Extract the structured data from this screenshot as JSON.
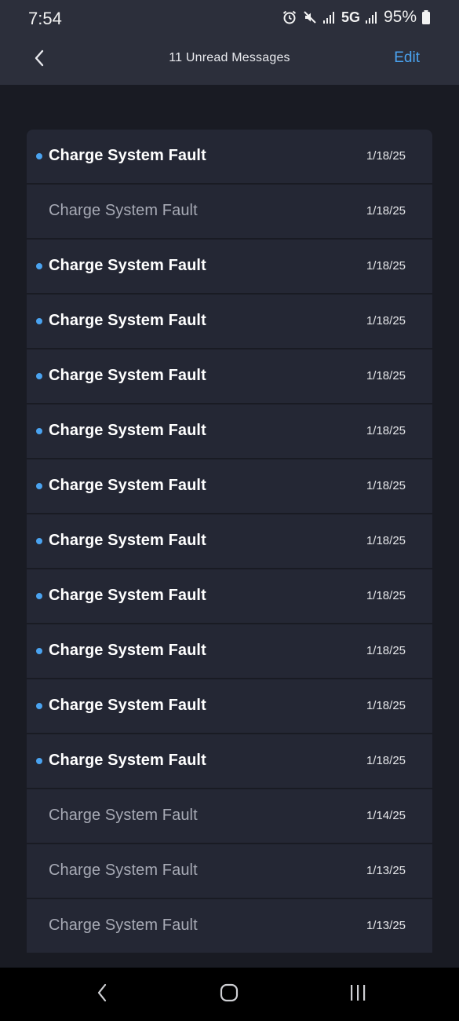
{
  "status_bar": {
    "time": "7:54",
    "network": "5G",
    "battery": "95%",
    "icons": [
      "alarm-icon",
      "mute-icon",
      "signal-icon",
      "signal-icon",
      "battery-icon"
    ]
  },
  "header": {
    "title": "11 Unread Messages",
    "edit_label": "Edit",
    "back_icon": "chevron-left-icon"
  },
  "colors": {
    "accent": "#4aa3f0",
    "row_background": "#242734",
    "page_background": "#191b23",
    "header_background": "#2c2f3b"
  },
  "messages": [
    {
      "title": "Charge System Fault",
      "date": "1/18/25",
      "unread": true
    },
    {
      "title": "Charge System Fault",
      "date": "1/18/25",
      "unread": false
    },
    {
      "title": "Charge System Fault",
      "date": "1/18/25",
      "unread": true
    },
    {
      "title": "Charge System Fault",
      "date": "1/18/25",
      "unread": true
    },
    {
      "title": "Charge System Fault",
      "date": "1/18/25",
      "unread": true
    },
    {
      "title": "Charge System Fault",
      "date": "1/18/25",
      "unread": true
    },
    {
      "title": "Charge System Fault",
      "date": "1/18/25",
      "unread": true
    },
    {
      "title": "Charge System Fault",
      "date": "1/18/25",
      "unread": true
    },
    {
      "title": "Charge System Fault",
      "date": "1/18/25",
      "unread": true
    },
    {
      "title": "Charge System Fault",
      "date": "1/18/25",
      "unread": true
    },
    {
      "title": "Charge System Fault",
      "date": "1/18/25",
      "unread": true
    },
    {
      "title": "Charge System Fault",
      "date": "1/18/25",
      "unread": true
    },
    {
      "title": "Charge System Fault",
      "date": "1/14/25",
      "unread": false
    },
    {
      "title": "Charge System Fault",
      "date": "1/13/25",
      "unread": false
    },
    {
      "title": "Charge System Fault",
      "date": "1/13/25",
      "unread": false
    }
  ],
  "nav_bar": {
    "icons": [
      "back-nav-icon",
      "home-icon",
      "recents-icon"
    ]
  }
}
